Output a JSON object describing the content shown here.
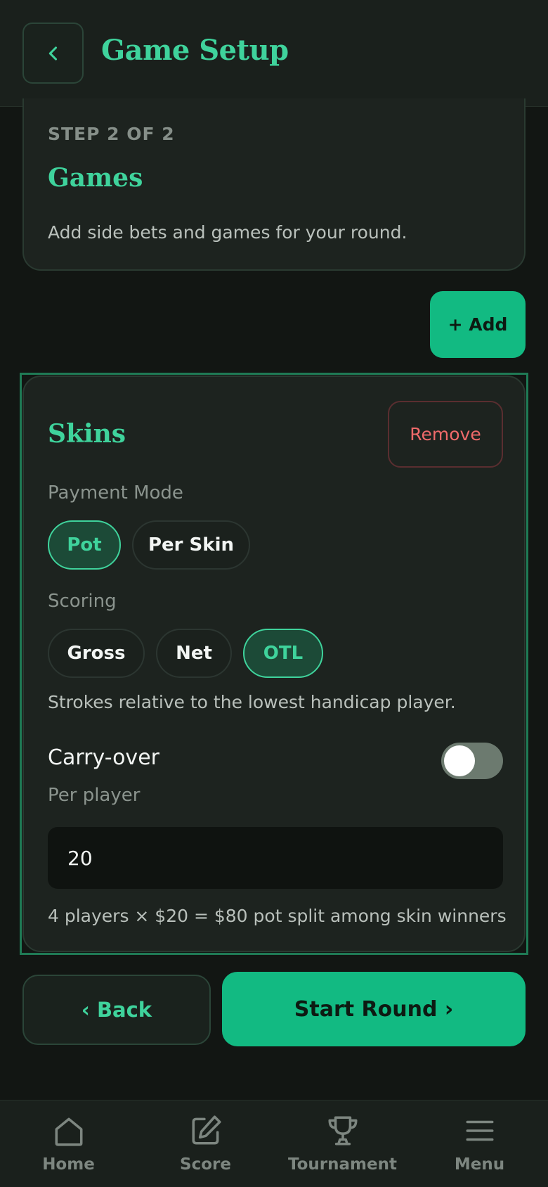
{
  "header": {
    "title": "Game Setup",
    "back_icon": "chevron-left-icon"
  },
  "step": {
    "label": "STEP 2 OF 2",
    "title": "Games",
    "description": "Add side bets and games for your round."
  },
  "add_button": "+ Add",
  "game": {
    "title": "Skins",
    "remove_label": "Remove",
    "payment_mode": {
      "label": "Payment Mode",
      "options": [
        "Pot",
        "Per Skin"
      ],
      "selected": "Pot"
    },
    "scoring": {
      "label": "Scoring",
      "options": [
        "Gross",
        "Net",
        "OTL"
      ],
      "selected": "OTL",
      "hint": "Strokes relative to the lowest handicap player."
    },
    "carry_over": {
      "label": "Carry-over",
      "enabled": false
    },
    "per_player": {
      "label": "Per player",
      "value": "20"
    },
    "summary": "4 players × $20 = $80 pot split among skin winners"
  },
  "footer": {
    "back_label": "‹ Back",
    "start_label": "Start Round ›"
  },
  "nav": [
    {
      "label": "Home",
      "icon": "home-icon"
    },
    {
      "label": "Score",
      "icon": "edit-icon"
    },
    {
      "label": "Tournament",
      "icon": "trophy-icon"
    },
    {
      "label": "Menu",
      "icon": "menu-icon"
    }
  ],
  "colors": {
    "accent": "#3fd39c",
    "primary_button": "#12ba82",
    "danger": "#ef6a6a",
    "background": "#121613"
  }
}
